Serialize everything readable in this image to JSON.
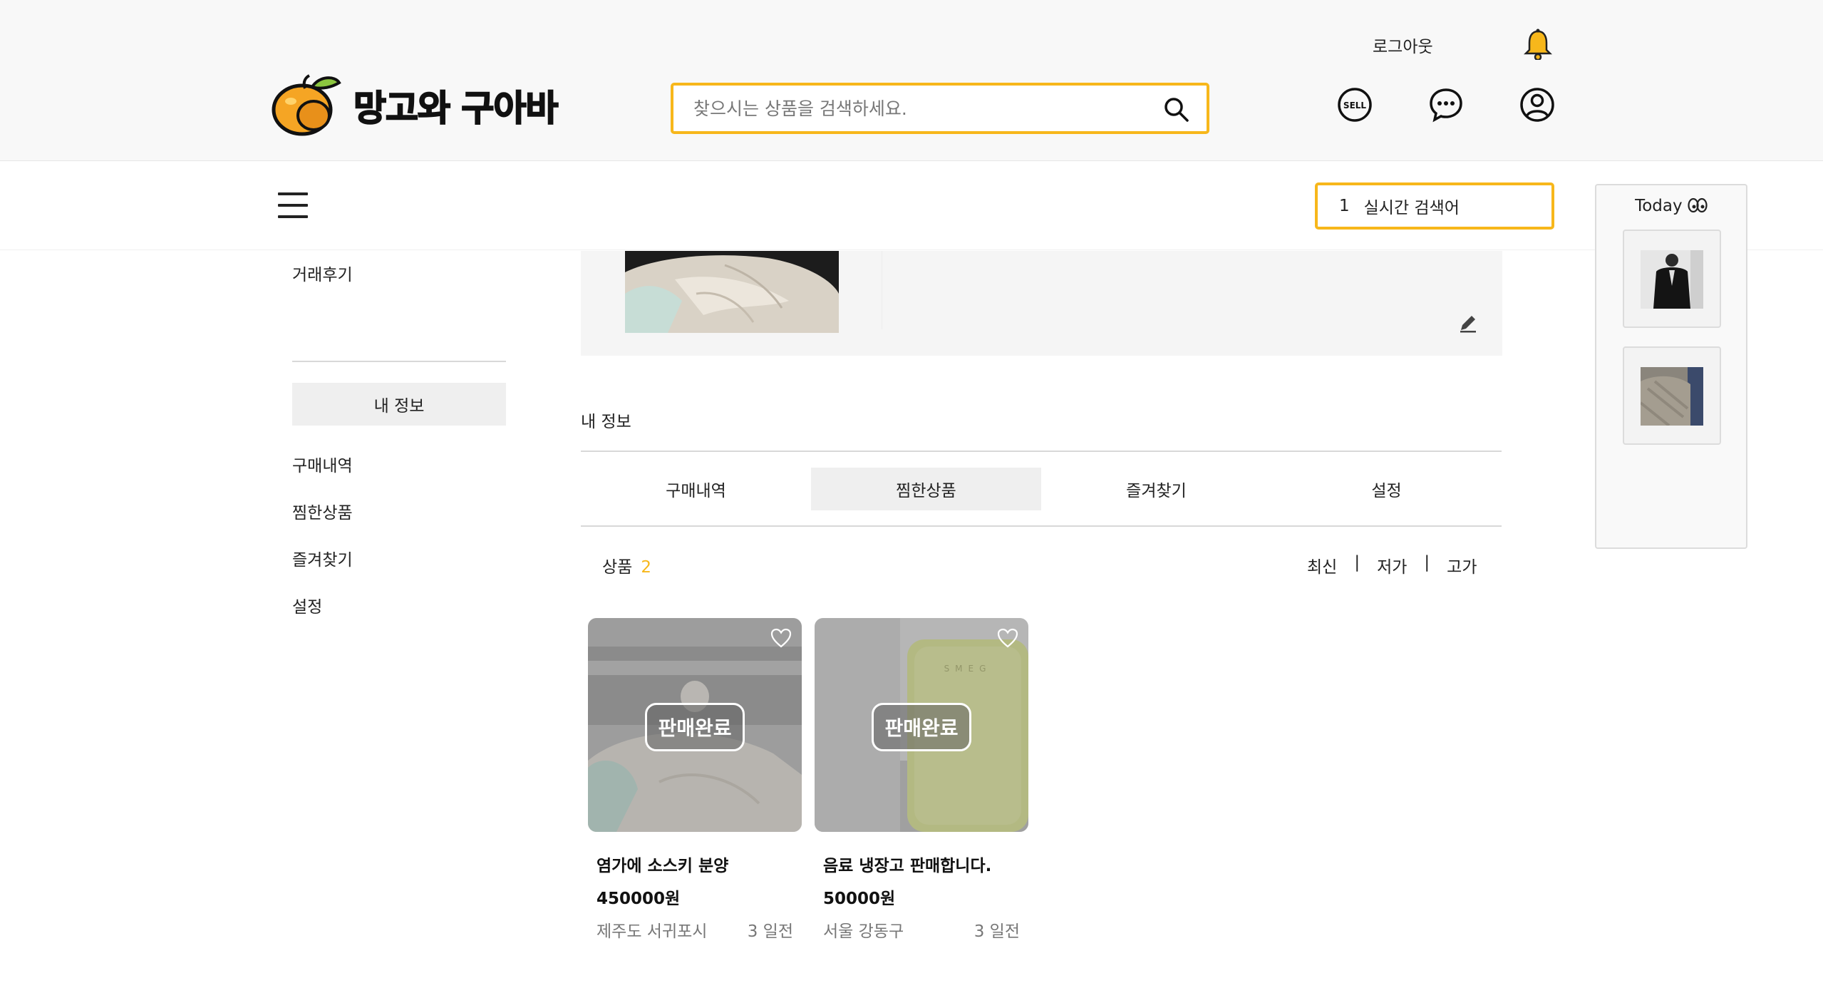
{
  "header": {
    "logo_text": "망고와 구아바",
    "search_placeholder": "찾으시는 상품을 검색하세요.",
    "logout_label": "로그아웃",
    "accent_color": "#f7b71b",
    "icons": [
      "bell-icon",
      "sell-icon",
      "chat-icon",
      "user-icon",
      "search-icon",
      "menu-icon"
    ],
    "sell_icon_text": "SELL"
  },
  "realtime": {
    "rank": "1",
    "label": "실시간 검색어"
  },
  "sidebar": {
    "review_link": "거래후기",
    "my_info_label": "내 정보",
    "links": [
      "구매내역",
      "찜한상품",
      "즐겨찾기",
      "설정"
    ]
  },
  "main": {
    "section_title": "내 정보",
    "tabs": [
      {
        "label": "구매내역",
        "active": false
      },
      {
        "label": "찜한상품",
        "active": true
      },
      {
        "label": "즐겨찾기",
        "active": false
      },
      {
        "label": "설정",
        "active": false
      }
    ],
    "count_label": "상품",
    "count_value": "2",
    "sort": {
      "latest": "최신",
      "low": "저가",
      "high": "고가",
      "separator": "|"
    }
  },
  "products": [
    {
      "title": "염가에 소스키 분양",
      "price": "450000원",
      "location": "제주도 서귀포시",
      "ago": "3 일전",
      "status": "판매완료"
    },
    {
      "title": "음료 냉장고 판매합니다.",
      "price": "50000원",
      "location": "서울 강동구",
      "ago": "3 일전",
      "status": "판매완료",
      "fridge_brand": "SMEG"
    }
  ],
  "today_panel": {
    "title": "Today",
    "items": [
      "recent-item-jacket",
      "recent-item-sweater"
    ]
  }
}
